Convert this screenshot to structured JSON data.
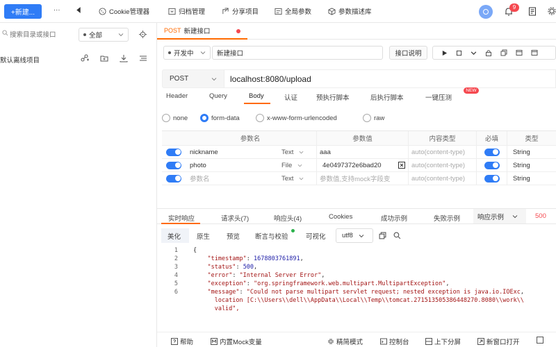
{
  "toolbar": {
    "new_label": "+新建...",
    "more": "···",
    "items": [
      "Cookie管理器",
      "归档管理",
      "分享项目",
      "全局参数",
      "参数描述库"
    ],
    "notification_count": "9"
  },
  "sidebar": {
    "search_placeholder": "搜索目录或接口",
    "filter_value": "全部",
    "project_name": "默认离线项目"
  },
  "tab": {
    "method": "POST",
    "title": "新建接口"
  },
  "request": {
    "status": "开发中",
    "name": "新建接口",
    "doc_label": "接口说明",
    "method": "POST",
    "url": "localhost:8080/upload"
  },
  "req_tabs": [
    "Header",
    "Query",
    "Body",
    "认证",
    "预执行脚本",
    "后执行脚本",
    "一键压测"
  ],
  "req_active": "Body",
  "new_badge": "NEW",
  "body_types": [
    "none",
    "form-data",
    "x-www-form-urlencoded",
    "raw"
  ],
  "body_selected": "form-data",
  "params": {
    "headers": [
      "参数名",
      "参数值",
      "内容类型",
      "必填",
      "类型"
    ],
    "rows": [
      {
        "name": "nickname",
        "type": "Text",
        "value": "aaa",
        "content_type": "auto(content-type)",
        "vtype": "String"
      },
      {
        "name": "photo",
        "type": "File",
        "value": "4e0497372e6bad20",
        "content_type": "auto(content-type)",
        "vtype": "String"
      }
    ],
    "new_row": {
      "name_placeholder": "参数名",
      "type": "Text",
      "value_placeholder": "参数值,支持mock字段变",
      "content_type": "auto(content-type)",
      "vtype": "String"
    }
  },
  "response": {
    "tabs": [
      "实时响应",
      "请求头(7)",
      "响应头(4)",
      "Cookies",
      "成功示例",
      "失败示例"
    ],
    "example_label": "响应示例",
    "status_code": "500",
    "views": [
      "美化",
      "原生",
      "预览",
      "断言与校验",
      "可视化"
    ],
    "encoding": "utf8",
    "code_lines": [
      {
        "n": "1",
        "t": "{"
      },
      {
        "n": "2",
        "key": "\"timestamp\"",
        "val": "1678803761891",
        "vtype": "num"
      },
      {
        "n": "3",
        "key": "\"status\"",
        "val": "500",
        "vtype": "num"
      },
      {
        "n": "4",
        "key": "\"error\"",
        "val": "\"Internal Server Error\"",
        "vtype": "str"
      },
      {
        "n": "5",
        "key": "\"exception\"",
        "val": "\"org.springframework.web.multipart.MultipartException\"",
        "vtype": "str"
      },
      {
        "n": "6",
        "key": "\"message\"",
        "val": "\"Could not parse multipart servlet request; nested exception is java.io.IOExc",
        "vtype": "str"
      },
      {
        "n": "",
        "t": "      location [C:\\\\Users\\\\dell\\\\AppData\\\\Local\\\\Temp\\\\tomcat.271513505386448270.8080\\\\work\\\\"
      },
      {
        "n": "",
        "t": "      valid\","
      }
    ]
  },
  "footer": [
    "帮助",
    "内置Mock变量",
    "精简模式",
    "控制台",
    "上下分屏",
    "新窗口打开"
  ]
}
